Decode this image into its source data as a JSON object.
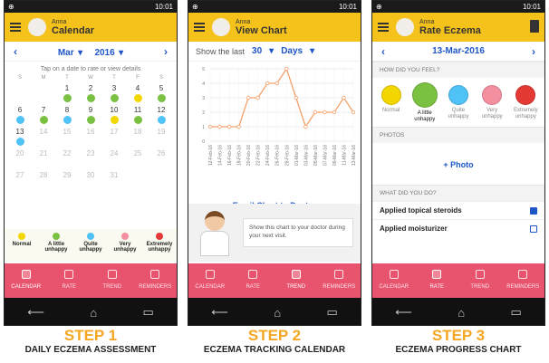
{
  "colors": {
    "accent": "#f5c21b",
    "tab": "#e8536e",
    "link": "#1e56c8",
    "normal": "#f2d600",
    "little": "#7ac142",
    "quite": "#4fc3f7",
    "very": "#f48fa0",
    "extremely": "#e53935"
  },
  "status": {
    "time": "10:01"
  },
  "screen1": {
    "user": "Anna",
    "title": "Calendar",
    "month": "Mar",
    "year": "2016",
    "hint": "Tap on a date to rate or view details",
    "weekdays": [
      "S",
      "M",
      "T",
      "W",
      "T",
      "F",
      "S"
    ],
    "days": [
      {
        "n": "",
        "c": ""
      },
      {
        "n": "",
        "c": ""
      },
      {
        "n": "1",
        "c": "little"
      },
      {
        "n": "2",
        "c": "little"
      },
      {
        "n": "3",
        "c": "little"
      },
      {
        "n": "4",
        "c": "normal"
      },
      {
        "n": "5",
        "c": "little"
      },
      {
        "n": "6",
        "c": "quite"
      },
      {
        "n": "7",
        "c": "little"
      },
      {
        "n": "8",
        "c": "quite"
      },
      {
        "n": "9",
        "c": "little"
      },
      {
        "n": "10",
        "c": "normal"
      },
      {
        "n": "11",
        "c": "little"
      },
      {
        "n": "12",
        "c": "quite"
      },
      {
        "n": "13",
        "c": "quite"
      },
      {
        "n": "14",
        "c": "",
        "dim": true
      },
      {
        "n": "15",
        "c": "",
        "dim": true
      },
      {
        "n": "16",
        "c": "",
        "dim": true
      },
      {
        "n": "17",
        "c": "",
        "dim": true
      },
      {
        "n": "18",
        "c": "",
        "dim": true
      },
      {
        "n": "19",
        "c": "",
        "dim": true
      },
      {
        "n": "20",
        "c": "",
        "dim": true
      },
      {
        "n": "21",
        "c": "",
        "dim": true
      },
      {
        "n": "22",
        "c": "",
        "dim": true
      },
      {
        "n": "23",
        "c": "",
        "dim": true
      },
      {
        "n": "24",
        "c": "",
        "dim": true
      },
      {
        "n": "25",
        "c": "",
        "dim": true
      },
      {
        "n": "26",
        "c": "",
        "dim": true
      },
      {
        "n": "27",
        "c": "",
        "dim": true
      },
      {
        "n": "28",
        "c": "",
        "dim": true
      },
      {
        "n": "29",
        "c": "",
        "dim": true
      },
      {
        "n": "30",
        "c": "",
        "dim": true
      },
      {
        "n": "31",
        "c": "",
        "dim": true
      },
      {
        "n": "",
        "c": ""
      },
      {
        "n": "",
        "c": ""
      }
    ],
    "legend": [
      {
        "label": "Normal",
        "color": "normal"
      },
      {
        "label": "A little unhappy",
        "color": "little"
      },
      {
        "label": "Quite unhappy",
        "color": "quite"
      },
      {
        "label": "Very unhappy",
        "color": "very"
      },
      {
        "label": "Extremely unhappy",
        "color": "extremely"
      }
    ]
  },
  "screen2": {
    "user": "Anna",
    "title": "View Chart",
    "show_label": "Show the last",
    "count": "30",
    "unit": "Days",
    "email": "Email Chart to Doctor",
    "doctor_text": "Show this chart to your doctor during your next visit."
  },
  "screen3": {
    "user": "Anna",
    "title": "Rate Eczema",
    "date": "13-Mar-2016",
    "feel_header": "HOW DID YOU FEEL?",
    "faces": [
      {
        "label": "Normal",
        "color": "normal"
      },
      {
        "label": "A little unhappy",
        "color": "little",
        "sel": true
      },
      {
        "label": "Quite unhappy",
        "color": "quite"
      },
      {
        "label": "Very unhappy",
        "color": "very"
      },
      {
        "label": "Extremely unhappy",
        "color": "extremely"
      }
    ],
    "photos_header": "PHOTOS",
    "photo_button": "+ Photo",
    "did_header": "WHAT DID YOU DO?",
    "actions": [
      {
        "label": "Applied topical steroids",
        "checked": true
      },
      {
        "label": "Applied moisturizer",
        "checked": false
      }
    ]
  },
  "tabs": [
    "CALENDAR",
    "RATE",
    "TREND",
    "REMINDERS"
  ],
  "steps": [
    {
      "step": "STEP 1",
      "caption": "DAILY ECZEMA ASSESSMENT"
    },
    {
      "step": "STEP 2",
      "caption": "ECZEMA TRACKING CALENDAR"
    },
    {
      "step": "STEP 3",
      "caption": "ECZEMA PROGRESS CHART"
    }
  ],
  "chart_data": {
    "type": "line",
    "x": [
      "12-Feb-16",
      "14-Feb-16",
      "16-Feb-16",
      "18-Feb-16",
      "20-Feb-16",
      "22-Feb-16",
      "24-Feb-16",
      "26-Feb-16",
      "28-Feb-16",
      "01-Mar-16",
      "03-Mar-16",
      "05-Mar-16",
      "07-Mar-16",
      "09-Mar-16",
      "11-Mar-16",
      "13-Mar-16"
    ],
    "y": [
      1,
      1,
      1,
      1,
      3,
      3,
      4,
      4,
      5,
      3,
      1,
      2,
      2,
      2,
      3,
      2
    ],
    "ylim": [
      0,
      5
    ],
    "yticks": [
      0,
      1,
      2,
      3,
      4,
      5
    ],
    "color": "#f4a06b",
    "grid": true
  }
}
